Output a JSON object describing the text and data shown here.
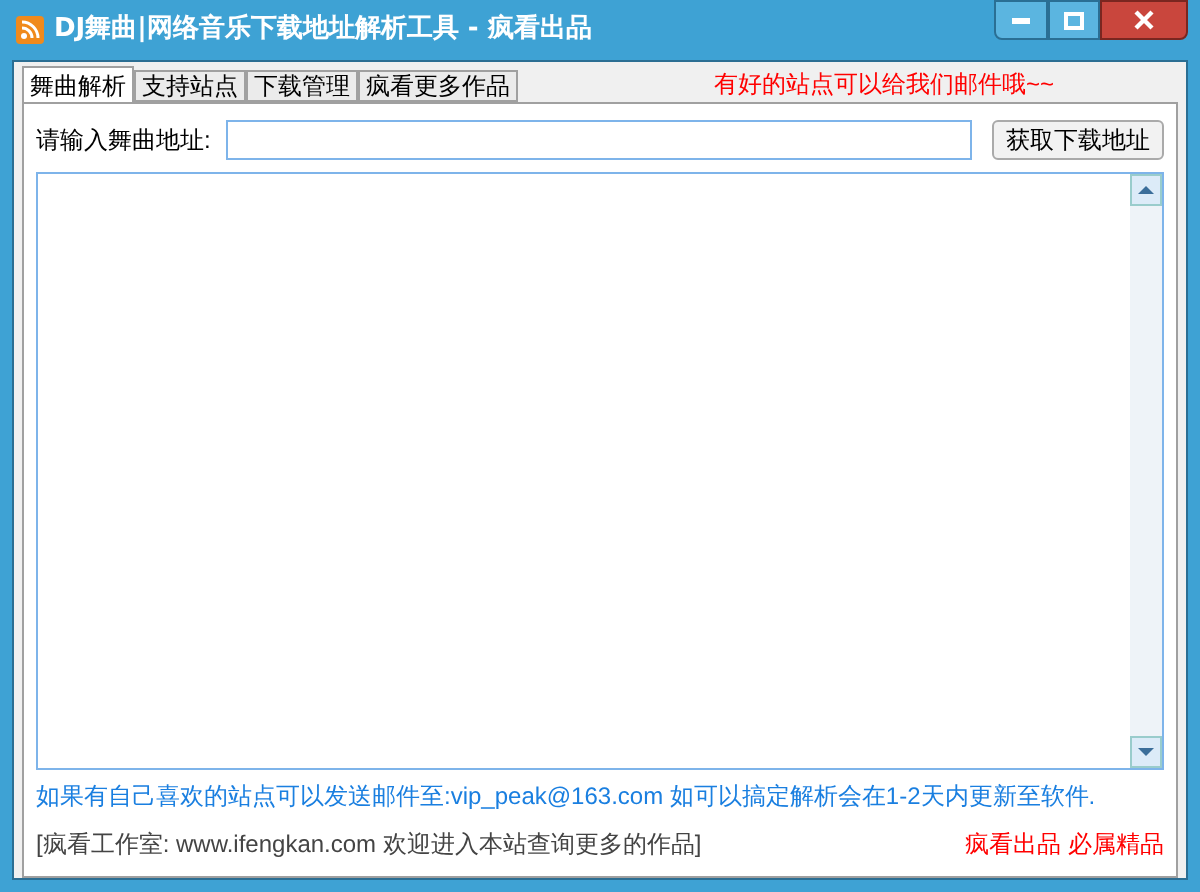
{
  "window": {
    "title": "DJ舞曲|网络音乐下载地址解析工具 - 疯看出品"
  },
  "tabs": [
    {
      "label": "舞曲解析",
      "selected": true
    },
    {
      "label": "支持站点",
      "selected": false
    },
    {
      "label": "下载管理",
      "selected": false
    },
    {
      "label": "疯看更多作品",
      "selected": false
    }
  ],
  "notice": "有好的站点可以给我们邮件哦~~",
  "url_label": "请输入舞曲地址:",
  "fetch_button": "获取下载地址",
  "info_text": "如果有自己喜欢的站点可以发送邮件至:vip_peak@163.com  如可以搞定解析会在1-2天内更新至软件.",
  "footer_text": "[疯看工作室: www.ifengkan.com 欢迎进入本站查询更多的作品]",
  "footer_slogan": "疯看出品 必属精品"
}
